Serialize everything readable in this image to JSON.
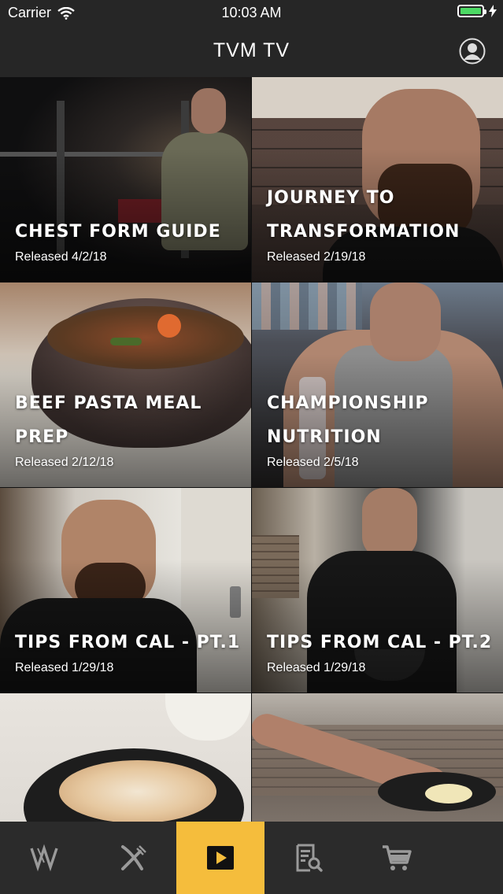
{
  "status_bar": {
    "carrier": "Carrier",
    "time": "10:03 AM"
  },
  "header": {
    "title": "TVM TV"
  },
  "videos": [
    {
      "title": "CHEST FORM GUIDE",
      "released": "Released 4/2/18"
    },
    {
      "title": "JOURNEY TO\nTRANSFORMATION",
      "released": "Released 2/19/18"
    },
    {
      "title": "BEEF PASTA MEAL PREP",
      "released": "Released 2/12/18"
    },
    {
      "title": "CHAMPIONSHIP NUTRITION",
      "released": "Released 2/5/18"
    },
    {
      "title": "TIPS FROM CAL - PT.1",
      "released": "Released 1/29/18"
    },
    {
      "title": "TIPS FROM CAL - PT.2",
      "released": "Released 1/29/18"
    },
    {
      "title": "",
      "released": ""
    },
    {
      "title": "",
      "released": ""
    }
  ],
  "tabs": [
    {
      "icon": "logo-icon",
      "active": false
    },
    {
      "icon": "fork-knife-icon",
      "active": false
    },
    {
      "icon": "play-icon",
      "active": true
    },
    {
      "icon": "search-document-icon",
      "active": false
    },
    {
      "icon": "cart-icon",
      "active": false
    }
  ],
  "colors": {
    "accent": "#f5bd3c",
    "bar": "#262626",
    "battery": "#4cd964"
  }
}
